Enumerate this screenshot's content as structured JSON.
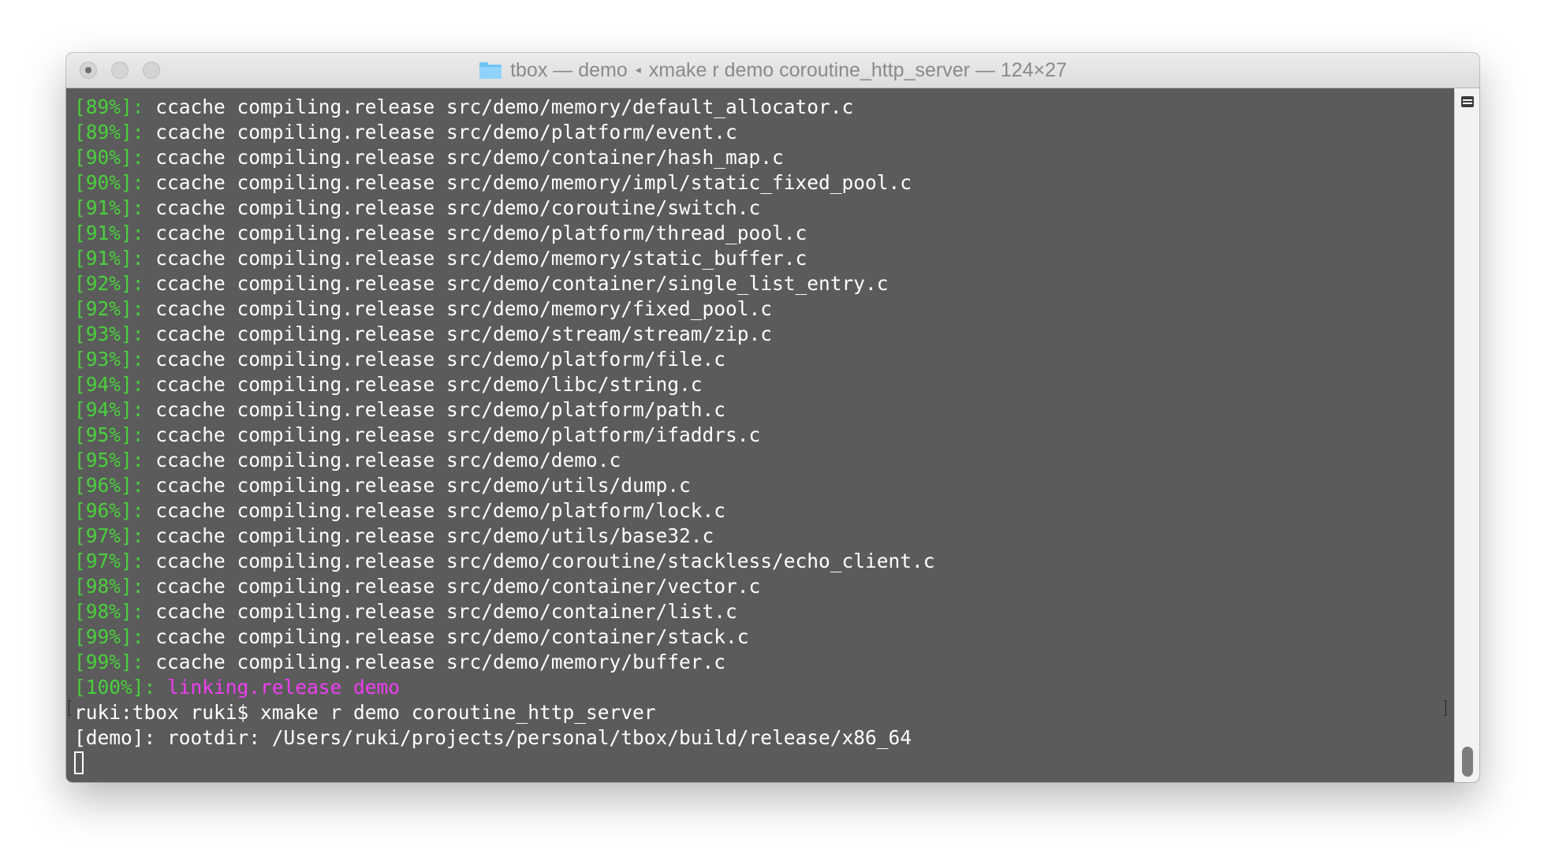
{
  "window": {
    "title_dir": "tbox — demo",
    "title_cmd": "xmake r demo coroutine_http_server — 124×27",
    "title_sep_glyph": "◂",
    "folder_icon_color": "#6ec3f4"
  },
  "colors": {
    "terminal_bg": "#5b5b5b",
    "progress_green": "#4ad03c",
    "link_magenta": "#ee3ef0",
    "text_white": "#ffffff"
  },
  "build_lines": [
    {
      "pct": "[89%]:",
      "text": " ccache compiling.release src/demo/memory/default_allocator.c"
    },
    {
      "pct": "[89%]:",
      "text": " ccache compiling.release src/demo/platform/event.c"
    },
    {
      "pct": "[90%]:",
      "text": " ccache compiling.release src/demo/container/hash_map.c"
    },
    {
      "pct": "[90%]:",
      "text": " ccache compiling.release src/demo/memory/impl/static_fixed_pool.c"
    },
    {
      "pct": "[91%]:",
      "text": " ccache compiling.release src/demo/coroutine/switch.c"
    },
    {
      "pct": "[91%]:",
      "text": " ccache compiling.release src/demo/platform/thread_pool.c"
    },
    {
      "pct": "[91%]:",
      "text": " ccache compiling.release src/demo/memory/static_buffer.c"
    },
    {
      "pct": "[92%]:",
      "text": " ccache compiling.release src/demo/container/single_list_entry.c"
    },
    {
      "pct": "[92%]:",
      "text": " ccache compiling.release src/demo/memory/fixed_pool.c"
    },
    {
      "pct": "[93%]:",
      "text": " ccache compiling.release src/demo/stream/stream/zip.c"
    },
    {
      "pct": "[93%]:",
      "text": " ccache compiling.release src/demo/platform/file.c"
    },
    {
      "pct": "[94%]:",
      "text": " ccache compiling.release src/demo/libc/string.c"
    },
    {
      "pct": "[94%]:",
      "text": " ccache compiling.release src/demo/platform/path.c"
    },
    {
      "pct": "[95%]:",
      "text": " ccache compiling.release src/demo/platform/ifaddrs.c"
    },
    {
      "pct": "[95%]:",
      "text": " ccache compiling.release src/demo/demo.c"
    },
    {
      "pct": "[96%]:",
      "text": " ccache compiling.release src/demo/utils/dump.c"
    },
    {
      "pct": "[96%]:",
      "text": " ccache compiling.release src/demo/platform/lock.c"
    },
    {
      "pct": "[97%]:",
      "text": " ccache compiling.release src/demo/utils/base32.c"
    },
    {
      "pct": "[97%]:",
      "text": " ccache compiling.release src/demo/coroutine/stackless/echo_client.c"
    },
    {
      "pct": "[98%]:",
      "text": " ccache compiling.release src/demo/container/vector.c"
    },
    {
      "pct": "[98%]:",
      "text": " ccache compiling.release src/demo/container/list.c"
    },
    {
      "pct": "[99%]:",
      "text": " ccache compiling.release src/demo/container/stack.c"
    },
    {
      "pct": "[99%]:",
      "text": " ccache compiling.release src/demo/memory/buffer.c"
    }
  ],
  "link_line": {
    "pct": "[100%]:",
    "text": " linking.release demo"
  },
  "prompt_line": "ruki:tbox ruki$ xmake r demo coroutine_http_server",
  "output_line": "[demo]: rootdir: /Users/ruki/projects/personal/tbox/build/release/x86_64"
}
